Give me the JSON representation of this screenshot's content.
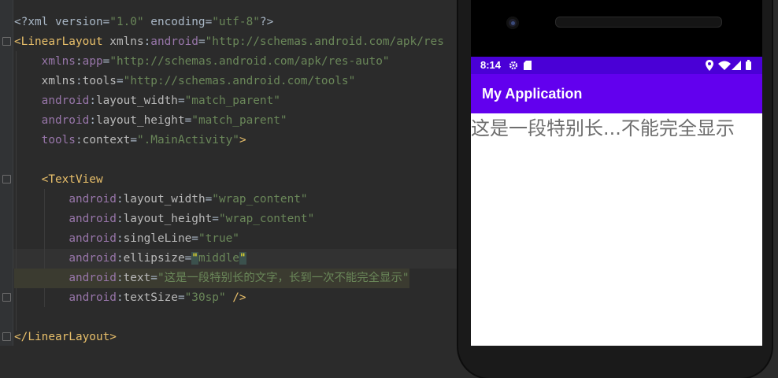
{
  "editor": {
    "lines": [
      {
        "segs": [
          [
            "plain",
            "<?xml version="
          ],
          [
            "str",
            "\"1.0\""
          ],
          [
            "plain",
            " encoding="
          ],
          [
            "str",
            "\"utf-8\""
          ],
          [
            "plain",
            "?>"
          ]
        ]
      },
      {
        "segs": [
          [
            "tag",
            "<LinearLayout "
          ],
          [
            "attr",
            "xmlns"
          ],
          [
            "plain",
            ":"
          ],
          [
            "ns",
            "android"
          ],
          [
            "plain",
            "="
          ],
          [
            "str",
            "\"http://schemas.android.com/apk/res"
          ]
        ]
      },
      {
        "segs": [
          [
            "plain",
            "    "
          ],
          [
            "ns",
            "xmlns"
          ],
          [
            "plain",
            ":"
          ],
          [
            "ns",
            "app"
          ],
          [
            "plain",
            "="
          ],
          [
            "str",
            "\"http://schemas.android.com/apk/res-auto\""
          ]
        ]
      },
      {
        "segs": [
          [
            "plain",
            "    "
          ],
          [
            "attr",
            "xmlns"
          ],
          [
            "plain",
            ":"
          ],
          [
            "attr",
            "tools"
          ],
          [
            "plain",
            "="
          ],
          [
            "str",
            "\"http://schemas.android.com/tools\""
          ]
        ]
      },
      {
        "segs": [
          [
            "plain",
            "    "
          ],
          [
            "ns",
            "android"
          ],
          [
            "plain",
            ":"
          ],
          [
            "attr",
            "layout_width"
          ],
          [
            "plain",
            "="
          ],
          [
            "str",
            "\"match_parent\""
          ]
        ]
      },
      {
        "segs": [
          [
            "plain",
            "    "
          ],
          [
            "ns",
            "android"
          ],
          [
            "plain",
            ":"
          ],
          [
            "attr",
            "layout_height"
          ],
          [
            "plain",
            "="
          ],
          [
            "str",
            "\"match_parent\""
          ]
        ]
      },
      {
        "segs": [
          [
            "plain",
            "    "
          ],
          [
            "ns",
            "tools"
          ],
          [
            "plain",
            ":"
          ],
          [
            "attr",
            "context"
          ],
          [
            "plain",
            "="
          ],
          [
            "str",
            "\".MainActivity\""
          ],
          [
            "tag",
            ">"
          ]
        ]
      },
      {
        "segs": [
          [
            "plain",
            ""
          ]
        ]
      },
      {
        "segs": [
          [
            "plain",
            "    "
          ],
          [
            "tag",
            "<TextView"
          ]
        ]
      },
      {
        "segs": [
          [
            "plain",
            "        "
          ],
          [
            "ns",
            "android"
          ],
          [
            "plain",
            ":"
          ],
          [
            "attr",
            "layout_width"
          ],
          [
            "plain",
            "="
          ],
          [
            "str",
            "\"wrap_content\""
          ]
        ]
      },
      {
        "segs": [
          [
            "plain",
            "        "
          ],
          [
            "ns",
            "android"
          ],
          [
            "plain",
            ":"
          ],
          [
            "attr",
            "layout_height"
          ],
          [
            "plain",
            "="
          ],
          [
            "str",
            "\"wrap_content\""
          ]
        ]
      },
      {
        "segs": [
          [
            "plain",
            "        "
          ],
          [
            "ns",
            "android"
          ],
          [
            "plain",
            ":"
          ],
          [
            "attr",
            "singleLine"
          ],
          [
            "plain",
            "="
          ],
          [
            "str",
            "\"true\""
          ]
        ]
      },
      {
        "segs": [
          [
            "plain",
            "        "
          ],
          [
            "ns",
            "android"
          ],
          [
            "plain",
            ":"
          ],
          [
            "attr",
            "ellipsize"
          ],
          [
            "plain",
            "="
          ],
          [
            "bracket-hl",
            "\""
          ],
          [
            "str",
            "middle"
          ],
          [
            "bracket-hl",
            "\""
          ]
        ]
      },
      {
        "segs": [
          [
            "plain",
            "        "
          ],
          [
            "ns",
            "android"
          ],
          [
            "plain",
            ":"
          ],
          [
            "attr",
            "text"
          ],
          [
            "plain",
            "="
          ],
          [
            "str",
            "\"这是一段特别长的文字，长到一次不能完全显示\""
          ]
        ]
      },
      {
        "segs": [
          [
            "plain",
            "        "
          ],
          [
            "ns",
            "android"
          ],
          [
            "plain",
            ":"
          ],
          [
            "attr",
            "textSize"
          ],
          [
            "plain",
            "="
          ],
          [
            "str",
            "\"30sp\""
          ],
          [
            "tag",
            " />"
          ]
        ]
      },
      {
        "segs": [
          [
            "plain",
            ""
          ]
        ]
      },
      {
        "segs": [
          [
            "tag",
            "</LinearLayout>"
          ]
        ]
      }
    ]
  },
  "phone": {
    "status_time": "8:14",
    "app_title": "My Application",
    "textview_text": "这是一段特别长...不能完全显示"
  }
}
